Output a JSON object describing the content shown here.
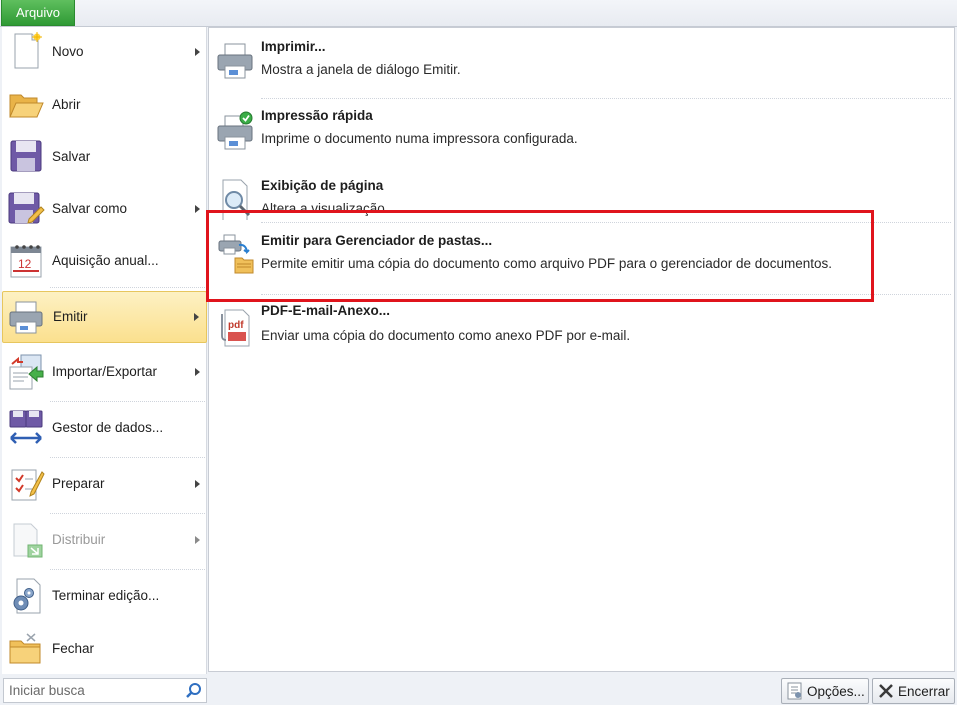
{
  "file_tab": {
    "label": "Arquivo"
  },
  "left_menu": {
    "items": [
      {
        "label": "Novo",
        "icon": "new-document-icon",
        "submenu": true
      },
      {
        "label": "Abrir",
        "icon": "open-folder-icon",
        "submenu": false
      },
      {
        "label": "Salvar",
        "icon": "save-disk-icon",
        "submenu": false
      },
      {
        "label": "Salvar como",
        "icon": "save-as-icon",
        "submenu": true
      },
      {
        "label": "Aquisição anual...",
        "icon": "calendar-icon",
        "submenu": false
      },
      {
        "label": "Emitir",
        "icon": "printer-icon",
        "submenu": true,
        "selected": true
      },
      {
        "label": "Importar/Exportar",
        "icon": "import-export-icon",
        "submenu": true
      },
      {
        "label": "Gestor de dados...",
        "icon": "data-manager-icon",
        "submenu": false
      },
      {
        "label": "Preparar",
        "icon": "prepare-icon",
        "submenu": true
      },
      {
        "label": "Distribuir",
        "icon": "distribute-icon",
        "submenu": true,
        "disabled": true
      },
      {
        "label": "Terminar edição...",
        "icon": "finish-edit-icon",
        "submenu": false
      },
      {
        "label": "Fechar",
        "icon": "close-folder-icon",
        "submenu": false
      }
    ]
  },
  "submenu": {
    "items": [
      {
        "title": "Imprimir...",
        "description": "Mostra a janela de diálogo Emitir.",
        "icon": "printer-icon"
      },
      {
        "title": "Impressão rápida",
        "description": "Imprime o documento numa impressora configurada.",
        "icon": "quick-print-icon"
      },
      {
        "title": "Exibição de página",
        "description": "Altera a visualização",
        "icon": "page-preview-icon"
      },
      {
        "title": "Emitir para Gerenciador de pastas...",
        "description": "Permite emitir uma cópia do documento como arquivo PDF para o gerenciador de documentos.",
        "icon": "print-to-folder-icon"
      },
      {
        "title": "PDF-E-mail-Anexo...",
        "description": "Enviar uma cópia do documento como anexo PDF por e-mail.",
        "icon": "pdf-attachment-icon"
      }
    ]
  },
  "search": {
    "placeholder": "Iniciar busca"
  },
  "buttons": {
    "options_label": "Opções...",
    "exit_label": "Encerrar"
  },
  "colors": {
    "accent_green": "#2f9a35",
    "selection_yellow": "#fbe08e",
    "highlight_red": "#e0141c"
  }
}
